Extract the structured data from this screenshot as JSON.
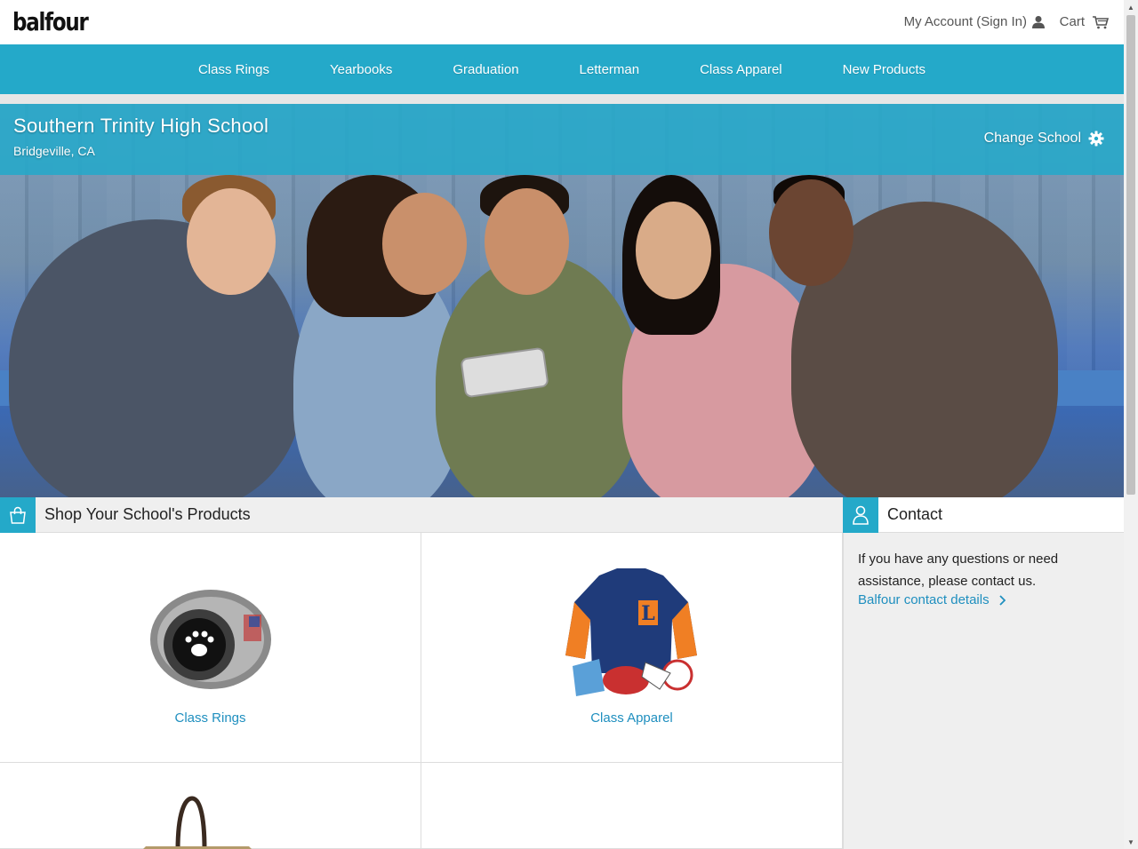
{
  "header": {
    "logo": "balfour",
    "account_label": "My Account (Sign In)",
    "cart_label": "Cart"
  },
  "nav": {
    "items": [
      {
        "label": "Class Rings"
      },
      {
        "label": "Yearbooks"
      },
      {
        "label": "Graduation"
      },
      {
        "label": "Letterman"
      },
      {
        "label": "Class Apparel"
      },
      {
        "label": "New Products"
      }
    ]
  },
  "school": {
    "name": "Southern Trinity High School",
    "location": "Bridgeville, CA",
    "change_label": "Change School"
  },
  "products": {
    "title": "Shop Your School's Products",
    "items": [
      {
        "label": "Class Rings"
      },
      {
        "label": "Class Apparel"
      },
      {
        "label": ""
      },
      {
        "label": ""
      }
    ]
  },
  "contact": {
    "title": "Contact",
    "text": "If you have any questions or need assistance, please contact us.",
    "link_label": "Balfour contact details"
  },
  "colors": {
    "brand": "#24a9c9",
    "link": "#1f8fbf"
  },
  "icons": [
    "user-icon",
    "cart-icon",
    "gear-icon",
    "shopping-bag-icon",
    "person-icon",
    "chevron-right-icon"
  ]
}
